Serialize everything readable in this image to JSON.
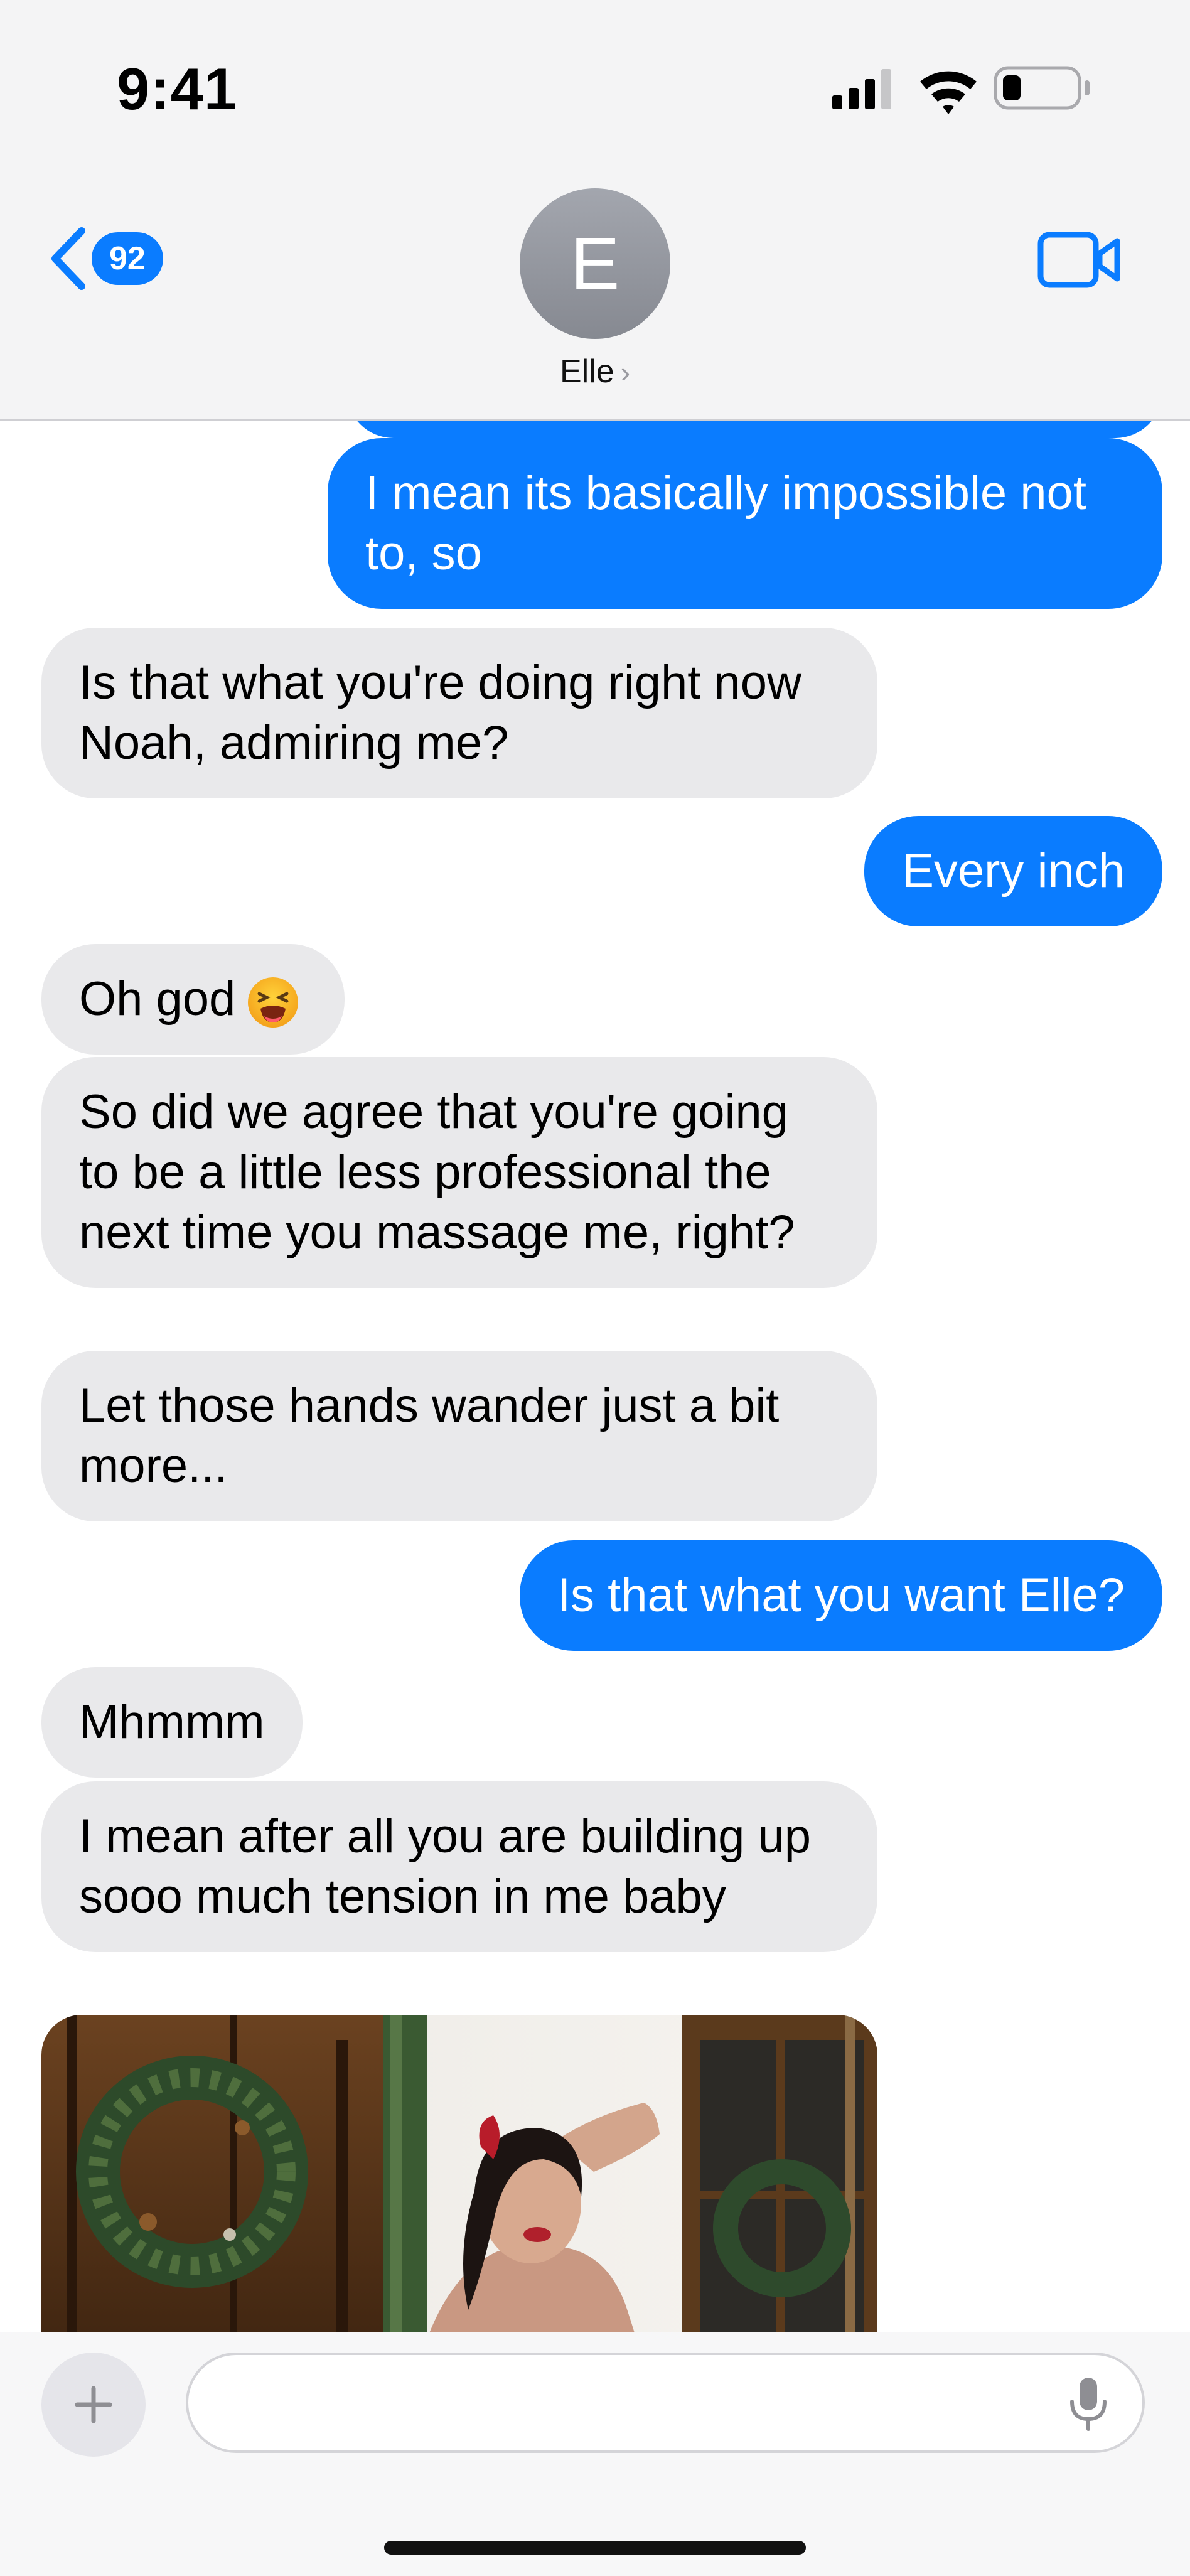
{
  "status_bar": {
    "time": "9:41"
  },
  "header": {
    "back_badge": "92",
    "avatar_initial": "E",
    "contact_name": "Elle",
    "icons": [
      "chevron-left-icon",
      "video-camera-icon",
      "signal-icon",
      "wifi-icon",
      "battery-icon"
    ]
  },
  "messages": [
    {
      "from": "me",
      "text": "I mean its basically impossible not to, so"
    },
    {
      "from": "them",
      "text": "Is that what you're doing right now Noah, admiring me?"
    },
    {
      "from": "me",
      "text": "Every inch"
    },
    {
      "from": "them",
      "text": "Oh god",
      "emoji": "tired-face-emoji"
    },
    {
      "from": "them",
      "text": "So did we agree that you're going to be a little less professional the next time you massage me, right?"
    },
    {
      "from": "them",
      "text": "Let those hands wander just a bit more..."
    },
    {
      "from": "me",
      "text": "Is that what you want Elle?"
    },
    {
      "from": "them",
      "text": "Mhmmm"
    },
    {
      "from": "them",
      "text": "I mean after all you are building up sooo much tension in me baby"
    },
    {
      "from": "them",
      "type": "photo"
    }
  ],
  "composer": {
    "value": "",
    "placeholder": ""
  },
  "colors": {
    "outgoing_bubble": "#0a7cff",
    "incoming_bubble": "#e9e9eb",
    "header_bg": "#f4f4f5"
  }
}
